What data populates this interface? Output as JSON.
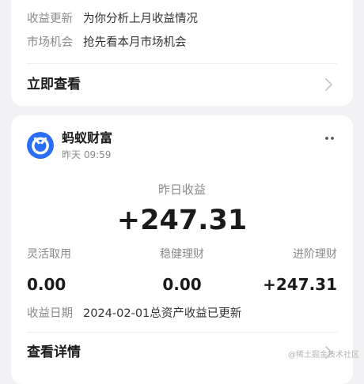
{
  "top_card": {
    "rows": [
      {
        "label": "收益更新",
        "value": "为你分析上月收益情况"
      },
      {
        "label": "市场机会",
        "value": "抢先看本月市场机会"
      }
    ],
    "action_label": "立即查看"
  },
  "main_card": {
    "brand_name": "蚂蚁财富",
    "time": "昨天 09:59",
    "yesterday_label": "昨日收益",
    "yesterday_value": "+247.31",
    "columns": [
      {
        "label": "灵活取用",
        "value": "0.00"
      },
      {
        "label": "稳健理财",
        "value": "0.00"
      },
      {
        "label": "进阶理财",
        "value": "+247.31"
      }
    ],
    "date_row": {
      "label": "收益日期",
      "value": "2024-02-01总资产收益已更新"
    },
    "action_label": "查看详情"
  },
  "watermark": "@稀土掘金技术社区",
  "colors": {
    "brand_blue": "#2a6ef5",
    "background": "#f2f2f4",
    "card": "#ffffff",
    "muted": "#8a8a8a"
  },
  "icons": {
    "brand": "ant-fortune-logo",
    "more": "more-dots-icon",
    "chevron": "chevron-right-icon"
  }
}
